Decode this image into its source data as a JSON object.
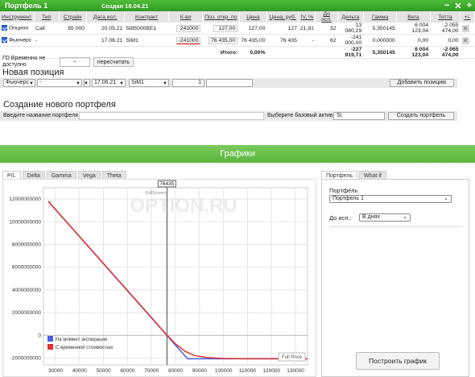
{
  "header": {
    "title": "Портфель 1",
    "created": "Создан 18.04.21"
  },
  "table": {
    "columns": [
      "Инструмент",
      "Тип",
      "Страйк",
      "Дата исп.",
      "Контракт",
      "К-во",
      "Поз. откр. по",
      "Цена",
      "Цена, руб.",
      "IV, %",
      "До исп.",
      "Дельта",
      "Гамма",
      "Вега",
      "Тетта",
      "+/-"
    ],
    "rows": [
      {
        "instrument": "Опцион",
        "type": "Call",
        "strike": "85 000",
        "date": "20.05.21",
        "contract": "Si85000BE1",
        "qty": "241000",
        "open": "127,00",
        "price": "127,00",
        "price_rub": "127",
        "iv": "21,91",
        "days": "32",
        "delta": "13 080,29",
        "gamma": "5,350145",
        "vega": "6 004 123,04",
        "theta": "-2 055 474,00"
      },
      {
        "instrument": "Фьючерс",
        "type": "-",
        "strike": "",
        "date": "17.06.21",
        "contract": "SiM1",
        "qty": "-241000",
        "open": "76 435,00",
        "price": "76 435,00",
        "price_rub": "76 435",
        "iv": "-",
        "days": "62",
        "delta": "-241 000,00",
        "gamma": "0,000000",
        "vega": "0,00",
        "theta": "0,00"
      }
    ],
    "total": {
      "label": "Итого:",
      "pct": "0,00%",
      "delta": "-227 919,71",
      "gamma": "5,350145",
      "vega": "6 004 123,04",
      "theta": "-2 065 474,00"
    }
  },
  "go": {
    "label": "ГО Временно не доступно",
    "value": "--",
    "recalc": "пересчитать"
  },
  "new_position": {
    "title": "Новая позиция",
    "instrument": "Фьючерс",
    "type": "-",
    "strike": "",
    "date": "17.06.21",
    "contract": "SiM1",
    "qty": "1",
    "add_button": "Добавить позицию"
  },
  "new_portfolio": {
    "title": "Создание нового портфеля",
    "name_label": "Введите название портфеля",
    "asset_label": "Выберите базовый актив",
    "asset": "Si",
    "create_button": "Создать портфель"
  },
  "graphs_title": "Графики",
  "chart_tabs": [
    "P/L",
    "Delta",
    "Gamma",
    "Vega",
    "Theta"
  ],
  "right_tabs": [
    "Портфель",
    "What if"
  ],
  "right_panel": {
    "portfolio_label": "Портфель",
    "portfolio_value": "Портфель 1",
    "till_label": "До исп.:",
    "till_value": "В днях",
    "build_button": "Построить график"
  },
  "chart_data": {
    "type": "line",
    "crosshair_label": "76435",
    "fullscreen_label": "FullScreen",
    "ylabel": "P/L",
    "watermark": "OPTION.RU",
    "fullprice_label": "Full Price",
    "xlim": [
      25000,
      135000
    ],
    "ylim": [
      -2600000000,
      13000000000
    ],
    "x_ticks": [
      30000,
      40000,
      50000,
      60000,
      70000,
      80000,
      90000,
      100000,
      110000,
      120000,
      130000
    ],
    "y_ticks": [
      -2000000000,
      0,
      2000000000,
      4000000000,
      6000000000,
      8000000000,
      10000000000,
      12000000000
    ],
    "series": [
      {
        "name": "На момент экспирации",
        "color": "#4a5ff0",
        "x": [
          27000,
          76435,
          85000,
          135000
        ],
        "y": [
          11800000000,
          0,
          -2063000000,
          -2063000000
        ]
      },
      {
        "name": "С временной стоимостью",
        "color": "#e03030",
        "x": [
          27000,
          70000,
          74000,
          76435,
          80000,
          84000,
          88000,
          93000,
          100000,
          110000,
          135000
        ],
        "y": [
          11800000000,
          1563000000,
          600000000,
          30000000,
          -750000000,
          -1400000000,
          -1780000000,
          -1950000000,
          -2030000000,
          -2055000000,
          -2060000000
        ]
      }
    ]
  }
}
